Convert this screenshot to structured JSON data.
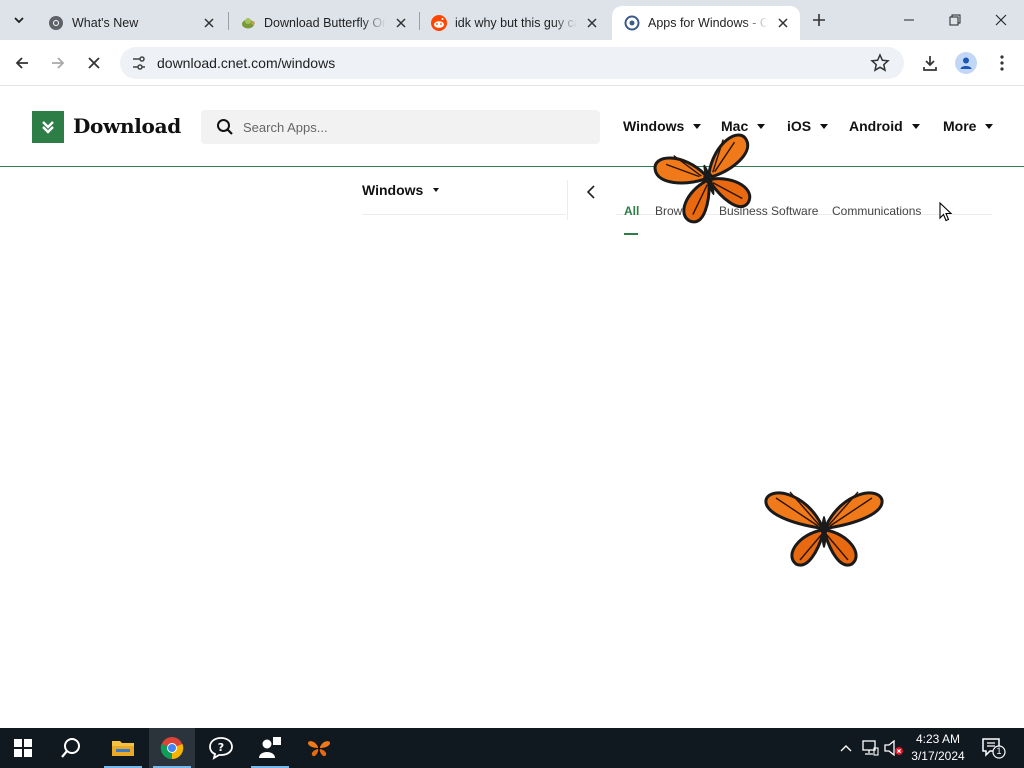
{
  "browser": {
    "tabs": [
      {
        "title": "What's New",
        "favicon": "chrome-icon",
        "active": false
      },
      {
        "title": "Download Butterfly On Desktop",
        "favicon": "turtle-icon",
        "active": false
      },
      {
        "title": "idk why but this guy came",
        "favicon": "reddit-icon",
        "active": false
      },
      {
        "title": "Apps for Windows - CNET Download",
        "favicon": "cnet-icon",
        "active": true
      }
    ],
    "url": "download.cnet.com/windows"
  },
  "site": {
    "logo_text": "Download",
    "search_placeholder": "Search Apps...",
    "nav": [
      "Windows",
      "Mac",
      "iOS",
      "Android",
      "More"
    ],
    "platform_selector": "Windows",
    "categories": [
      "All",
      "Browsers",
      "Business Software",
      "Communications"
    ],
    "active_category": "All",
    "brand_color": "#2d7d46"
  },
  "taskbar": {
    "apps": [
      "start-icon",
      "search-icon",
      "file-explorer-icon",
      "chrome-icon",
      "help-icon",
      "people-icon",
      "butterfly-icon"
    ],
    "time": "4:23 AM",
    "date": "3/17/2024",
    "notification_count": "1"
  }
}
